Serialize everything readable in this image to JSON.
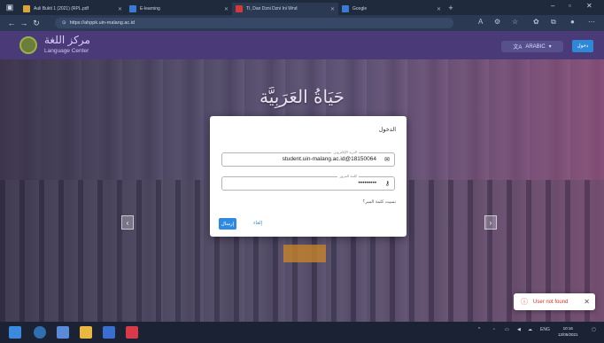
{
  "browser": {
    "tabs": [
      {
        "label": "Auli Bukti 1 (2021) (RPL.pdf",
        "color": "#d9a53a"
      },
      {
        "label": "E-learning",
        "color": "#3a7bd5"
      },
      {
        "label": "TI, Dan Dzni Dzni Ini Wnd",
        "color": "#d23a3a"
      },
      {
        "label": "Google",
        "color": "#3a7bd5"
      }
    ],
    "url": "https://ahppk.uin-malang.ac.id"
  },
  "site": {
    "logo_arabic": "مركز اللغة",
    "logo_english": "Language Center",
    "language_selector": "ARABIC",
    "login_button": "دخول",
    "hero_title": "حَيَاةُ العَرَبِيَّة",
    "accent_color": "#4a3a78"
  },
  "modal": {
    "title": "الدخول",
    "email_label": "البريد الإلكتروني",
    "email_value": "student.uin-malang.ac.id@18150064",
    "password_label": "كلمة المرور",
    "password_value": "•••••••••",
    "forgot_link": "نسيت كلمة السر؟",
    "send_button": "إرسال",
    "cancel_link": "إلغاء"
  },
  "toast": {
    "message": "User not found",
    "close": "✕"
  },
  "taskbar": {
    "language": "ENG",
    "time": "10:16",
    "date": "12/05/2021"
  }
}
